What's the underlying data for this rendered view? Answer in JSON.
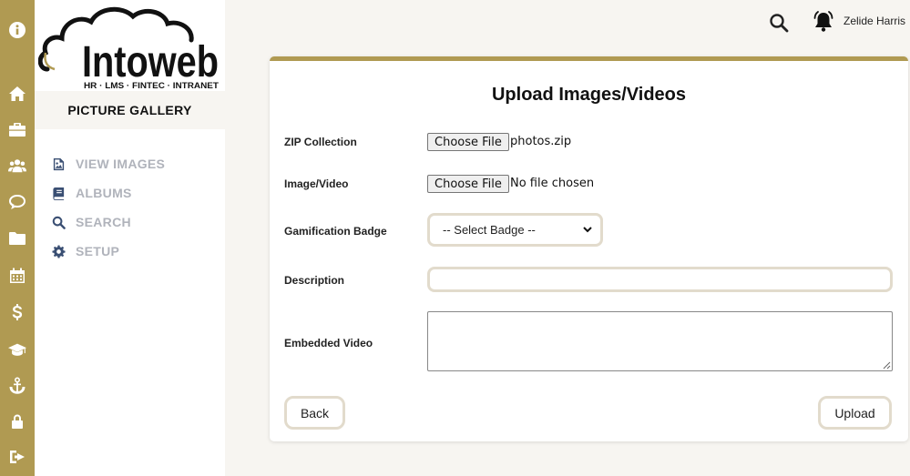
{
  "app": {
    "logo_text": "Intoweb",
    "logo_tagline": "HR · LMS · FINTEC · INTRANET"
  },
  "rail": {
    "icons": [
      "info-icon",
      "home-icon",
      "briefcase-icon",
      "users-icon",
      "chat-icon",
      "folder-icon",
      "calendar-icon",
      "dollar-icon",
      "graduation-cap-icon",
      "anchor-icon",
      "lock-icon",
      "sign-out-icon"
    ]
  },
  "sidebar": {
    "section_title": "PICTURE GALLERY",
    "items": [
      {
        "label": "VIEW IMAGES",
        "icon": "image-icon"
      },
      {
        "label": "ALBUMS",
        "icon": "book-icon"
      },
      {
        "label": "SEARCH",
        "icon": "search-icon"
      },
      {
        "label": "SETUP",
        "icon": "gear-icon"
      }
    ]
  },
  "header": {
    "user_name": "Zelide Harris"
  },
  "form": {
    "title": "Upload Images/Videos",
    "zip": {
      "label": "ZIP Collection",
      "button": "Choose File",
      "value": "photos.zip"
    },
    "image": {
      "label": "Image/Video",
      "button": "Choose File",
      "value": "No file chosen"
    },
    "badge": {
      "label": "Gamification Badge",
      "selected": "-- Select Badge --"
    },
    "description": {
      "label": "Description",
      "value": ""
    },
    "embedded": {
      "label": "Embedded Video",
      "value": ""
    },
    "back_label": "Back",
    "upload_label": "Upload"
  },
  "colors": {
    "accent": "#b09a52",
    "field_border": "#e2dbcc",
    "menu_icon": "#3a4f73",
    "menu_text": "#b0b3bb"
  }
}
